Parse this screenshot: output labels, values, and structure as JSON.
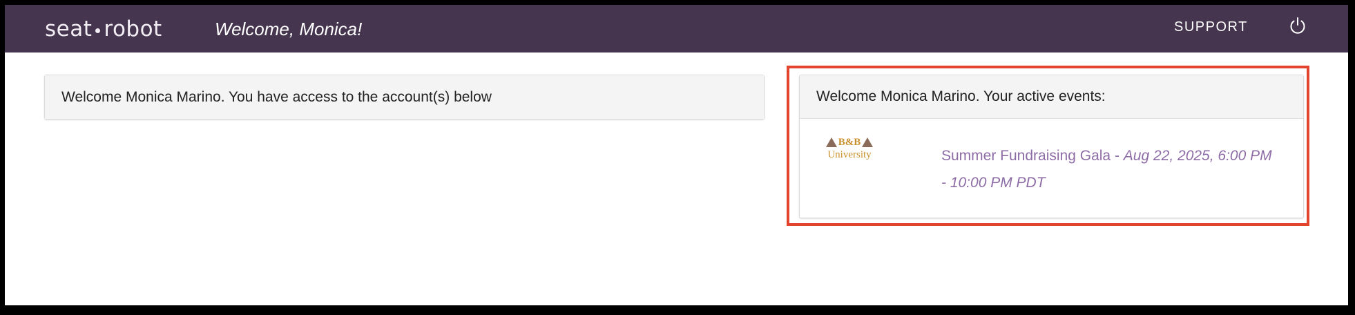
{
  "navbar": {
    "brand_left": "seat",
    "brand_right": "robot",
    "welcome": "Welcome, Monica!",
    "support_label": "SUPPORT",
    "power_icon": "power-icon"
  },
  "accounts_panel": {
    "heading": "Welcome Monica Marino. You have access to the account(s) below"
  },
  "events_panel": {
    "heading": "Welcome Monica Marino. Your active events:",
    "events": [
      {
        "logo_top": "B&B",
        "logo_bottom": "University",
        "name": "Summer Fundraising Gala",
        "separator": " - ",
        "date": "Aug 22, 2025, 6:00 PM - 10:00 PM PDT"
      }
    ]
  },
  "colors": {
    "navbar_bg": "#45354f",
    "link": "#8d6ca6",
    "highlight": "#e2442d"
  }
}
